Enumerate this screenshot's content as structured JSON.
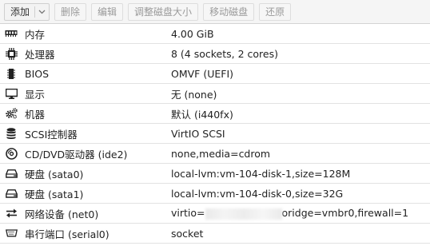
{
  "toolbar": {
    "add_label": "添加",
    "remove_label": "删除",
    "edit_label": "编辑",
    "resize_label": "调整磁盘大小",
    "move_label": "移动磁盘",
    "revert_label": "还原"
  },
  "rows": [
    {
      "icon": "memory-icon",
      "label": "内存",
      "value": "4.00 GiB"
    },
    {
      "icon": "cpu-icon",
      "label": "处理器",
      "value": "8 (4 sockets, 2 cores)"
    },
    {
      "icon": "bios-chip-icon",
      "label": "BIOS",
      "value": "OMVF (UEFI)"
    },
    {
      "icon": "monitor-icon",
      "label": "显示",
      "value": "无 (none)"
    },
    {
      "icon": "gears-icon",
      "label": "机器",
      "value": "默认 (i440fx)"
    },
    {
      "icon": "database-icon",
      "label": "SCSI控制器",
      "value": "VirtIO SCSI"
    },
    {
      "icon": "optical-disc-icon",
      "label": "CD/DVD驱动器 (ide2)",
      "value": "none,media=cdrom"
    },
    {
      "icon": "hard-disk-icon",
      "label": "硬盘 (sata0)",
      "value": "local-lvm:vm-104-disk-1,size=128M"
    },
    {
      "icon": "hard-disk-icon",
      "label": "硬盘 (sata1)",
      "value": "local-lvm:vm-104-disk-0,size=32G"
    },
    {
      "icon": "network-exchange-icon",
      "label": "网络设备 (net0)",
      "value_prefix": "virtio=",
      "value_suffix": "oridge=vmbr0,firewall=1"
    },
    {
      "icon": "serial-port-icon",
      "label": "串行端口 (serial0)",
      "value": "socket"
    }
  ]
}
